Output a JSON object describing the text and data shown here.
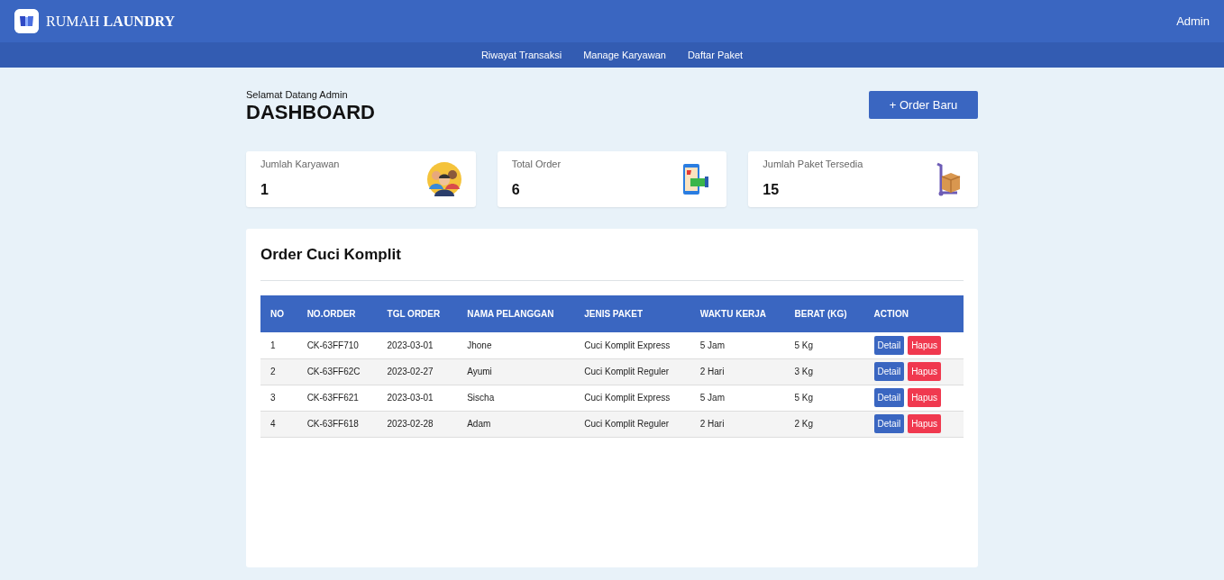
{
  "navbar": {
    "brand": "RUMAH **LAUNDRY**",
    "user": "Admin"
  },
  "menu": [
    "Riwayat Transaksi",
    "Manage Karyawan",
    "Daftar Paket"
  ],
  "header": {
    "greeting": "Selamat Datang Admin",
    "title": "DASHBOARD",
    "new_order_button": "+ Order Baru"
  },
  "stats": [
    {
      "kind": "people",
      "label": "Jumlah Karyawan",
      "value": "1"
    },
    {
      "kind": "payment",
      "label": "Total Order",
      "value": "6"
    },
    {
      "kind": "package",
      "label": "Jumlah Paket Tersedia",
      "value": "15"
    }
  ],
  "table": {
    "title": "Order Cuci Komplit",
    "columns": [
      "NO",
      "NO.ORDER",
      "TGL ORDER",
      "NAMA PELANGGAN",
      "JENIS PAKET",
      "WAKTU KERJA",
      "BERAT (KG)",
      "ACTION"
    ],
    "rows": [
      {
        "cells": [
          "1",
          "CK-63FF710",
          "2023-03-01",
          "Jhone",
          "Cuci Komplit Express",
          "5 Jam",
          "5 Kg"
        ],
        "actions": [
          "Detail",
          "Hapus"
        ]
      },
      {
        "cells": [
          "2",
          "CK-63FF62C",
          "2023-02-27",
          "Ayumi",
          "Cuci Komplit Reguler",
          "2 Hari",
          "3 Kg"
        ],
        "actions": [
          "Detail",
          "Hapus"
        ]
      },
      {
        "cells": [
          "3",
          "CK-63FF621",
          "2023-03-01",
          "Sischa",
          "Cuci Komplit Express",
          "5 Jam",
          "5 Kg"
        ],
        "actions": [
          "Detail",
          "Hapus"
        ]
      },
      {
        "cells": [
          "4",
          "CK-63FF618",
          "2023-02-28",
          "Adam",
          "Cuci Komplit Reguler",
          "2 Hari",
          "2 Kg"
        ],
        "actions": [
          "Detail",
          "Hapus"
        ]
      }
    ]
  }
}
